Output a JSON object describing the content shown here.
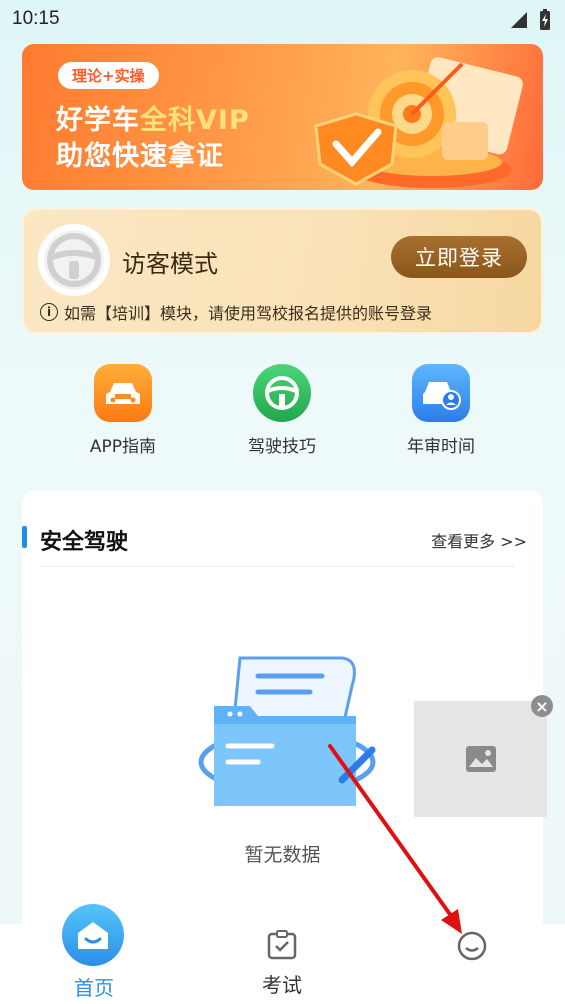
{
  "status_bar": {
    "time": "10:15"
  },
  "banner": {
    "tag": "理论+实操",
    "line1_main": "好学车",
    "line1_accent": "全科VIP",
    "line2": "助您快速拿证"
  },
  "guest": {
    "title": "访客模式",
    "login_label": "立即登录",
    "note": "如需【培训】模块，请使用驾校报名提供的账号登录"
  },
  "shortcuts": [
    {
      "label": "APP指南",
      "icon": "car-icon",
      "color": "#ff8a1f"
    },
    {
      "label": "驾驶技巧",
      "icon": "steering-wheel-icon",
      "color": "#2fbf5a"
    },
    {
      "label": "年审时间",
      "icon": "car-person-icon",
      "color": "#2b8fe8"
    }
  ],
  "safety": {
    "title": "安全驾驶",
    "more": "查看更多 >>",
    "empty_text": "暂无数据"
  },
  "tabs": {
    "home": "首页",
    "exam": "考试"
  },
  "colors": {
    "accent_blue": "#2b8fe8",
    "banner_orange": "#ff7a2f",
    "login_brown": "#8a5719",
    "annotation_red": "#e01010"
  }
}
